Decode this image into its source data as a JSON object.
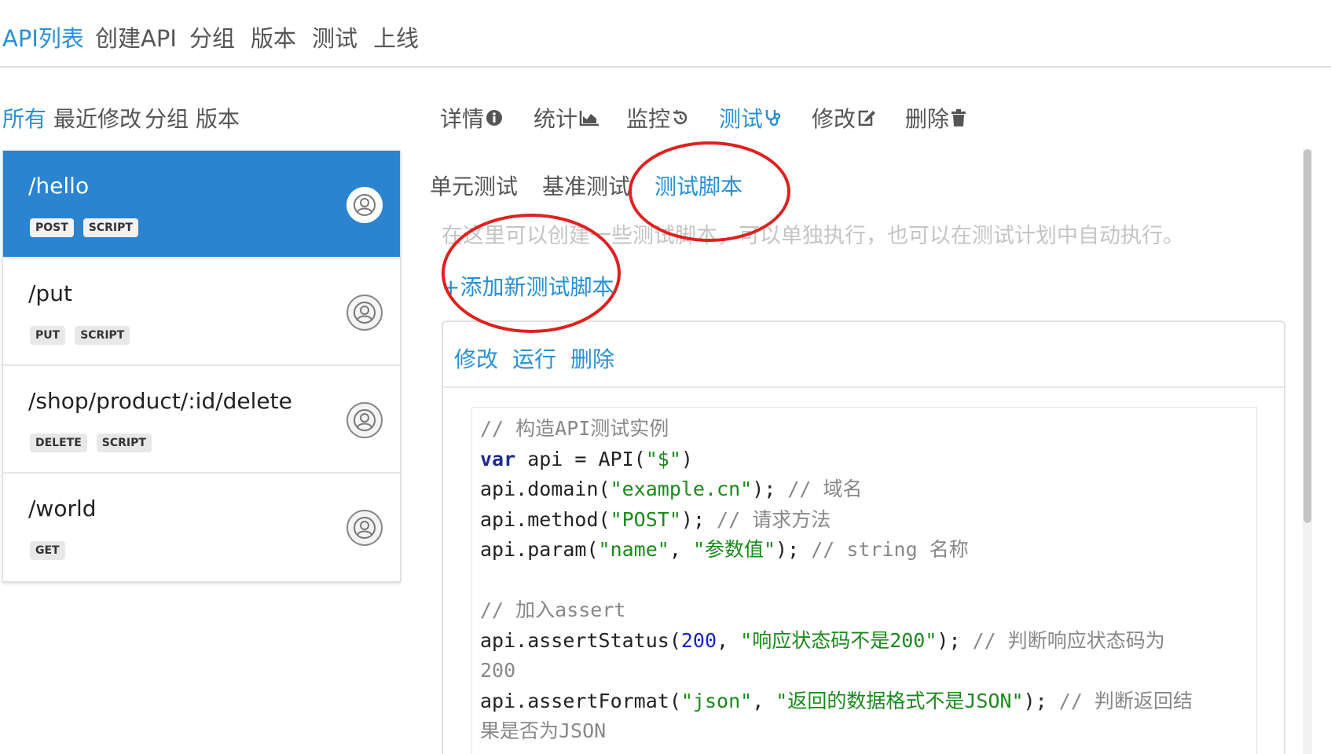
{
  "topnav": {
    "items": [
      "API列表",
      "创建API",
      "分组",
      "版本",
      "测试",
      "上线"
    ]
  },
  "filters": {
    "items": [
      "所有",
      "最近修改",
      "分组",
      "版本"
    ]
  },
  "api_list": [
    {
      "path": "/hello",
      "badges": [
        "POST",
        "SCRIPT"
      ],
      "avatar_icon": "user-avatar-icon"
    },
    {
      "path": "/put",
      "badges": [
        "PUT",
        "SCRIPT"
      ],
      "avatar_icon": "user-avatar-icon"
    },
    {
      "path": "/shop/product/:id/delete",
      "badges": [
        "DELETE",
        "SCRIPT"
      ],
      "avatar_icon": "user-avatar-icon"
    },
    {
      "path": "/world",
      "badges": [
        "GET"
      ],
      "avatar_icon": "user-avatar-icon"
    }
  ],
  "detail_tabs": [
    {
      "label": "详情",
      "icon": "info-icon"
    },
    {
      "label": "统计",
      "icon": "area-chart-icon"
    },
    {
      "label": "监控",
      "icon": "history-icon"
    },
    {
      "label": "测试",
      "icon": "stethoscope-icon"
    },
    {
      "label": "修改",
      "icon": "edit-icon"
    },
    {
      "label": "删除",
      "icon": "trash-icon"
    }
  ],
  "sub_tabs": [
    "单元测试",
    "基准测试",
    "测试脚本"
  ],
  "hint": "在这里可以创建一些测试脚本，可以单独执行，也可以在测试计划中自动执行。",
  "add_link": "+添加新测试脚本",
  "card_actions": [
    "修改",
    "运行",
    "删除"
  ],
  "code_lines": [
    "// 构造API测试实例",
    "var api = API(\"$\")",
    "api.domain(\"example.cn\"); // 域名",
    "api.method(\"POST\"); // 请求方法",
    "api.param(\"name\", \"参数值\"); // string 名称",
    "",
    "// 加入assert",
    "api.assertStatus(200, \"响应状态码不是200\"); // 判断响应状态码为",
    "200",
    "api.assertFormat(\"json\", \"返回的数据格式不是JSON\"); // 判断返回结",
    "果是否为JSON"
  ],
  "colors": {
    "accent": "#2a8fd6",
    "active_row": "#2a84d0",
    "annotation": "#e02020"
  }
}
